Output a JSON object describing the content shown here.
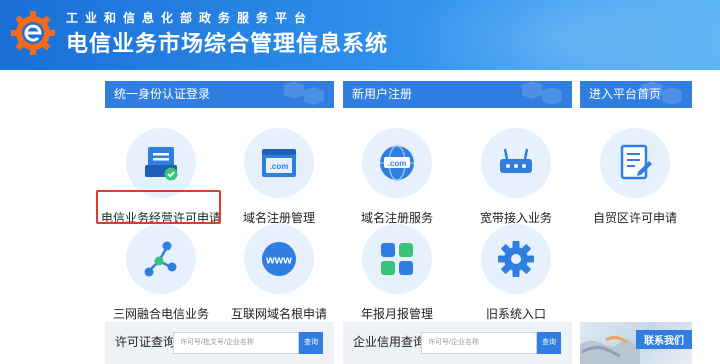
{
  "header": {
    "subtitle": "工业和信息化部政务服务平台",
    "title": "电信业务市场综合管理信息系统"
  },
  "sections": {
    "login": "统一身份认证登录",
    "register": "新用户注册",
    "home": "进入平台首页"
  },
  "services": [
    {
      "label": "电信业务经营许可申请",
      "icon": "document-tray-check-icon"
    },
    {
      "label": "域名注册管理",
      "icon": "browser-com-icon"
    },
    {
      "label": "域名注册服务",
      "icon": "globe-com-icon"
    },
    {
      "label": "宽带接入业务",
      "icon": "router-icon"
    },
    {
      "label": "自贸区许可申请",
      "icon": "document-edit-icon"
    },
    {
      "label": "三网融合电信业务",
      "icon": "network-nodes-icon"
    },
    {
      "label": "互联网域名根申请",
      "icon": "www-icon"
    },
    {
      "label": "年报月报管理",
      "icon": "grid-tiles-icon"
    },
    {
      "label": "旧系统入口",
      "icon": "gear-icon"
    }
  ],
  "license_search": {
    "title": "许可证查询",
    "placeholder": "许可号/批文号/企业名称",
    "button": "查询"
  },
  "credit_search": {
    "title": "企业信用查询",
    "placeholder": "许可号/企业名称",
    "button": "查询"
  },
  "contact": {
    "label": "联系我们"
  },
  "colors": {
    "primary": "#2f7ee0",
    "icon_bg": "#e6f1fd",
    "highlight": "#e23a2d"
  }
}
